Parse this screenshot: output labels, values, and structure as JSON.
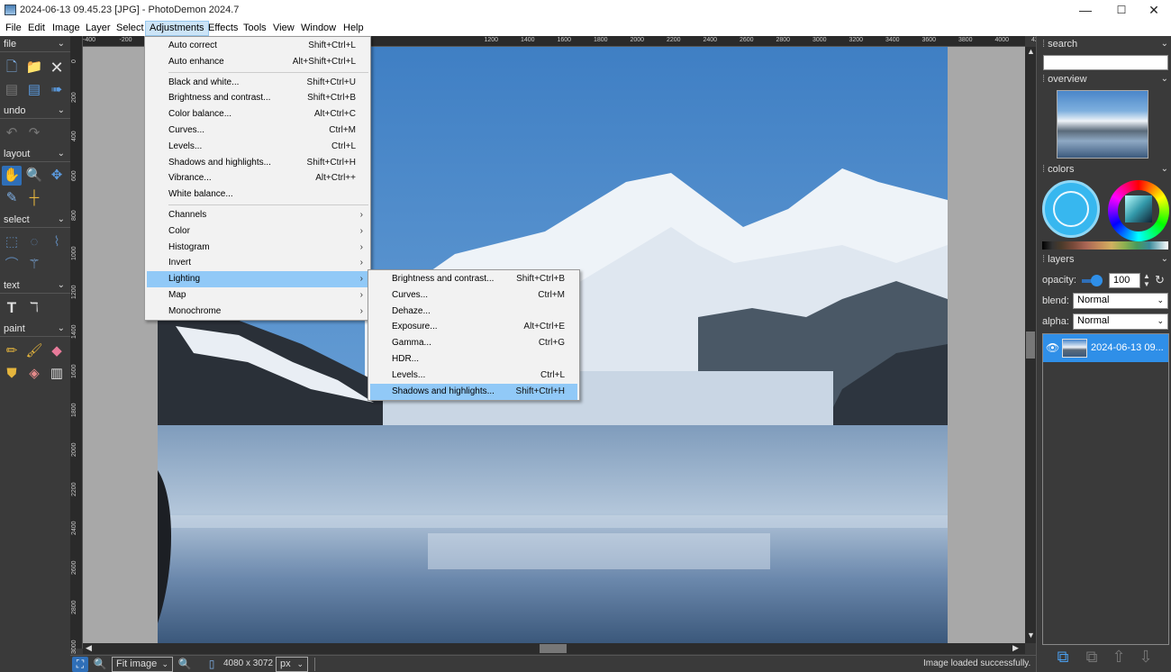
{
  "window": {
    "title": "2024-06-13 09.45.23 [JPG] - PhotoDemon 2024.7",
    "minimize": "—",
    "maximize": "☐",
    "close": "✕"
  },
  "menubar": [
    "File",
    "Edit",
    "Image",
    "Layer",
    "Select",
    "Adjustments",
    "Effects",
    "Tools",
    "View",
    "Window",
    "Help"
  ],
  "toolbox": {
    "sections": [
      "file",
      "undo",
      "layout",
      "select",
      "text",
      "paint"
    ]
  },
  "rulers": {
    "h": [
      "-400",
      "-200",
      "",
      "",
      "",
      "",
      "",
      "",
      "",
      "",
      "",
      "1200",
      "1400",
      "1600",
      "1800",
      "2000",
      "2200",
      "2400",
      "2600",
      "2800",
      "3000",
      "3200",
      "3400",
      "3600",
      "3800",
      "4000",
      "4200",
      "4400"
    ],
    "v": [
      "0",
      "200",
      "400",
      "600",
      "800",
      "1000",
      "1200",
      "1400",
      "1600",
      "1800",
      "2000",
      "2200",
      "2400",
      "2600",
      "2800",
      "3000"
    ]
  },
  "adjustments_menu": [
    {
      "label": "Auto correct",
      "shortcut": "Shift+Ctrl+L"
    },
    {
      "label": "Auto enhance",
      "shortcut": "Alt+Shift+Ctrl+L"
    },
    {
      "sep": true
    },
    {
      "label": "Black and white...",
      "shortcut": "Shift+Ctrl+U"
    },
    {
      "label": "Brightness and contrast...",
      "shortcut": "Shift+Ctrl+B"
    },
    {
      "label": "Color balance...",
      "shortcut": "Alt+Ctrl+C"
    },
    {
      "label": "Curves...",
      "shortcut": "Ctrl+M"
    },
    {
      "label": "Levels...",
      "shortcut": "Ctrl+L"
    },
    {
      "label": "Shadows and highlights...",
      "shortcut": "Shift+Ctrl+H"
    },
    {
      "label": "Vibrance...",
      "shortcut": "Alt+Ctrl++"
    },
    {
      "label": "White balance...",
      "shortcut": ""
    },
    {
      "sep": true
    },
    {
      "label": "Channels",
      "sub": true
    },
    {
      "label": "Color",
      "sub": true
    },
    {
      "label": "Histogram",
      "sub": true
    },
    {
      "label": "Invert",
      "sub": true
    },
    {
      "label": "Lighting",
      "sub": true,
      "hl": true
    },
    {
      "label": "Map",
      "sub": true
    },
    {
      "label": "Monochrome",
      "sub": true
    }
  ],
  "lighting_menu": [
    {
      "label": "Brightness and contrast...",
      "shortcut": "Shift+Ctrl+B"
    },
    {
      "label": "Curves...",
      "shortcut": "Ctrl+M"
    },
    {
      "label": "Dehaze...",
      "shortcut": ""
    },
    {
      "label": "Exposure...",
      "shortcut": "Alt+Ctrl+E"
    },
    {
      "label": "Gamma...",
      "shortcut": "Ctrl+G"
    },
    {
      "label": "HDR...",
      "shortcut": ""
    },
    {
      "label": "Levels...",
      "shortcut": "Ctrl+L"
    },
    {
      "label": "Shadows and highlights...",
      "shortcut": "Shift+Ctrl+H",
      "hl": true
    }
  ],
  "panel": {
    "search_title": "search",
    "search_value": "",
    "overview_title": "overview",
    "colors_title": "colors",
    "layers_title": "layers",
    "opacity_label": "opacity:",
    "opacity_value": "100",
    "blend_label": "blend:",
    "blend_value": "Normal",
    "alpha_label": "alpha:",
    "alpha_value": "Normal",
    "layer_name": "2024-06-13 09..."
  },
  "status": {
    "zoom": "Fit image",
    "size": "4080 x 3072",
    "unit": "px",
    "message": "Image loaded successfully."
  },
  "colors": {
    "accent": "#2f6fb8",
    "menu_highlight": "#91c9f7",
    "menu_bg": "#f2f2f2",
    "panel_bg": "#3a3a3a"
  }
}
